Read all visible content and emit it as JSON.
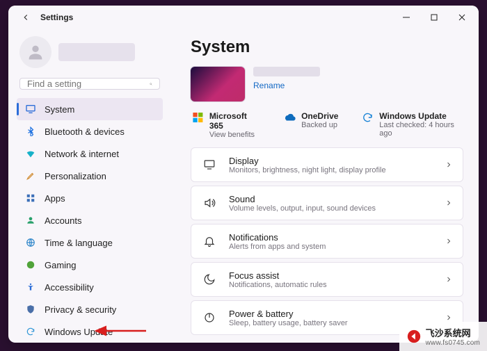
{
  "window": {
    "title": "Settings"
  },
  "search": {
    "placeholder": "Find a setting"
  },
  "sidebar": {
    "items": [
      {
        "label": "System",
        "icon": "monitor",
        "color": "#2b6dd8",
        "selected": true
      },
      {
        "label": "Bluetooth & devices",
        "icon": "bluetooth",
        "color": "#1a6fe0"
      },
      {
        "label": "Network & internet",
        "icon": "wifi",
        "color": "#17b1c8"
      },
      {
        "label": "Personalization",
        "icon": "brush",
        "color": "#d08a2e"
      },
      {
        "label": "Apps",
        "icon": "apps",
        "color": "#3b6fb8"
      },
      {
        "label": "Accounts",
        "icon": "person",
        "color": "#28a06a"
      },
      {
        "label": "Time & language",
        "icon": "globe",
        "color": "#2f86c9"
      },
      {
        "label": "Gaming",
        "icon": "gaming",
        "color": "#51a33a"
      },
      {
        "label": "Accessibility",
        "icon": "accessibility",
        "color": "#2b6dd8"
      },
      {
        "label": "Privacy & security",
        "icon": "shield",
        "color": "#4a6fa8"
      },
      {
        "label": "Windows Update",
        "icon": "update",
        "color": "#2f96d6"
      }
    ]
  },
  "page": {
    "title": "System",
    "rename": "Rename"
  },
  "info": {
    "m365": {
      "title": "Microsoft 365",
      "sub": "View benefits"
    },
    "onedrive": {
      "title": "OneDrive",
      "sub": "Backed up"
    },
    "update": {
      "title": "Windows Update",
      "sub": "Last checked: 4 hours ago"
    }
  },
  "cards": [
    {
      "key": "display",
      "title": "Display",
      "sub": "Monitors, brightness, night light, display profile",
      "icon": "monitor"
    },
    {
      "key": "sound",
      "title": "Sound",
      "sub": "Volume levels, output, input, sound devices",
      "icon": "sound"
    },
    {
      "key": "notifications",
      "title": "Notifications",
      "sub": "Alerts from apps and system",
      "icon": "bell"
    },
    {
      "key": "focus",
      "title": "Focus assist",
      "sub": "Notifications, automatic rules",
      "icon": "moon"
    },
    {
      "key": "power",
      "title": "Power & battery",
      "sub": "Sleep, battery usage, battery saver",
      "icon": "power"
    }
  ],
  "watermark": {
    "text": "飞沙系统网",
    "sub": "www.fs0745.com"
  }
}
